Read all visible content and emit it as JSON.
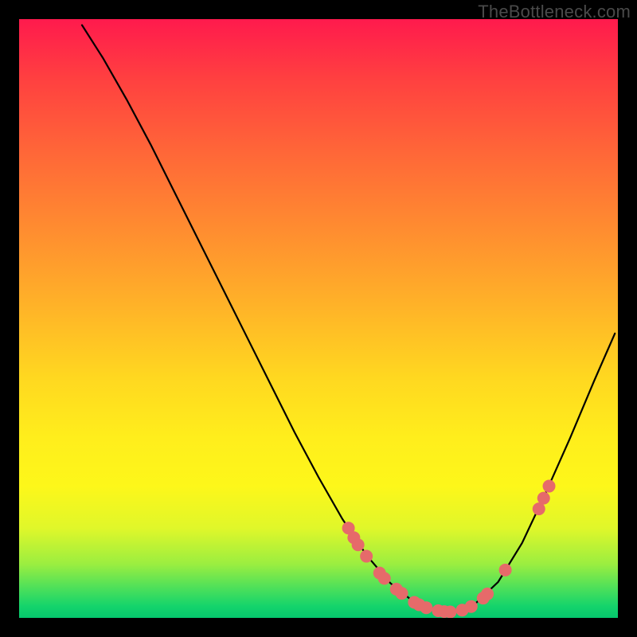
{
  "watermark": "TheBottleneck.com",
  "colors": {
    "marker": "#e66a6a",
    "curve": "#000000",
    "frame": "#000000"
  },
  "chart_data": {
    "type": "line",
    "title": "",
    "xlabel": "",
    "ylabel": "",
    "xlim": [
      0,
      100
    ],
    "ylim": [
      0,
      100
    ],
    "grid": false,
    "curve": [
      {
        "x": 10.5,
        "y": 99.0
      },
      {
        "x": 14.0,
        "y": 93.5
      },
      {
        "x": 18.0,
        "y": 86.5
      },
      {
        "x": 22.0,
        "y": 79.0
      },
      {
        "x": 26.0,
        "y": 71.0
      },
      {
        "x": 30.0,
        "y": 63.0
      },
      {
        "x": 34.0,
        "y": 55.0
      },
      {
        "x": 38.0,
        "y": 47.0
      },
      {
        "x": 42.0,
        "y": 39.0
      },
      {
        "x": 46.0,
        "y": 31.0
      },
      {
        "x": 50.0,
        "y": 23.5
      },
      {
        "x": 54.0,
        "y": 16.5
      },
      {
        "x": 58.0,
        "y": 10.5
      },
      {
        "x": 62.0,
        "y": 5.8
      },
      {
        "x": 66.0,
        "y": 2.6
      },
      {
        "x": 70.0,
        "y": 1.2
      },
      {
        "x": 73.0,
        "y": 1.0
      },
      {
        "x": 76.0,
        "y": 2.2
      },
      {
        "x": 80.0,
        "y": 6.0
      },
      {
        "x": 84.0,
        "y": 12.5
      },
      {
        "x": 88.0,
        "y": 21.0
      },
      {
        "x": 92.0,
        "y": 30.0
      },
      {
        "x": 96.0,
        "y": 39.5
      },
      {
        "x": 99.5,
        "y": 47.5
      }
    ],
    "markers": [
      {
        "x": 55.0,
        "y": 15.0
      },
      {
        "x": 55.9,
        "y": 13.4
      },
      {
        "x": 56.6,
        "y": 12.2
      },
      {
        "x": 58.0,
        "y": 10.3
      },
      {
        "x": 60.2,
        "y": 7.5
      },
      {
        "x": 61.0,
        "y": 6.6
      },
      {
        "x": 63.0,
        "y": 4.8
      },
      {
        "x": 63.9,
        "y": 4.1
      },
      {
        "x": 66.0,
        "y": 2.6
      },
      {
        "x": 66.8,
        "y": 2.2
      },
      {
        "x": 68.0,
        "y": 1.7
      },
      {
        "x": 70.0,
        "y": 1.2
      },
      {
        "x": 71.0,
        "y": 1.05
      },
      {
        "x": 72.0,
        "y": 1.0
      },
      {
        "x": 74.0,
        "y": 1.3
      },
      {
        "x": 75.5,
        "y": 1.9
      },
      {
        "x": 77.5,
        "y": 3.3
      },
      {
        "x": 78.2,
        "y": 4.0
      },
      {
        "x": 81.2,
        "y": 8.0
      },
      {
        "x": 86.8,
        "y": 18.2
      },
      {
        "x": 87.6,
        "y": 20.0
      },
      {
        "x": 88.5,
        "y": 22.0
      }
    ]
  }
}
